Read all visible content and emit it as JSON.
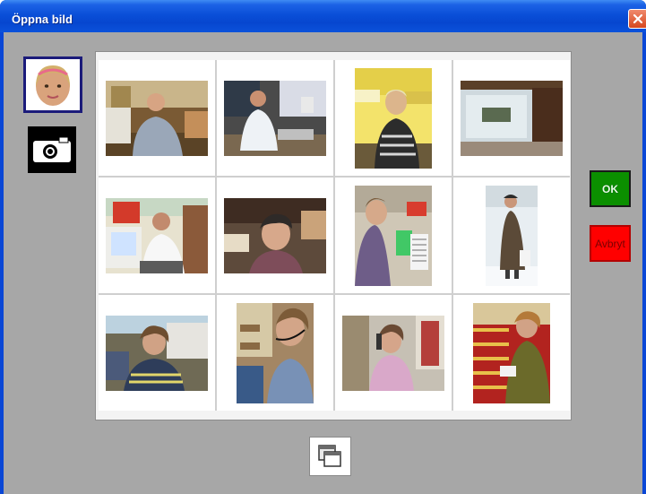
{
  "window": {
    "title": "Öppna bild",
    "close_icon": "close-icon"
  },
  "side": {
    "avatar_icon": "avatar",
    "camera_icon": "camera-icon"
  },
  "photos": [
    {
      "name": "photo-man-sweater-desk"
    },
    {
      "name": "photo-man-glasses-desk"
    },
    {
      "name": "photo-woman-blonde-office"
    },
    {
      "name": "photo-shop-window"
    },
    {
      "name": "photo-man-computer"
    },
    {
      "name": "photo-young-person-kitchen"
    },
    {
      "name": "photo-person-keyboard"
    },
    {
      "name": "photo-person-snow"
    },
    {
      "name": "photo-woman-computer"
    },
    {
      "name": "photo-woman-headset"
    },
    {
      "name": "photo-woman-phone"
    },
    {
      "name": "photo-woman-shop-red"
    }
  ],
  "buttons": {
    "ok": "OK",
    "cancel": "Avbryt",
    "windows_icon": "windows-icon"
  },
  "colors": {
    "titlebar": "#0a4fd8",
    "client_bg": "#a7a7a7",
    "ok_bg": "#0b8f00",
    "cancel_bg": "#ff0000"
  }
}
